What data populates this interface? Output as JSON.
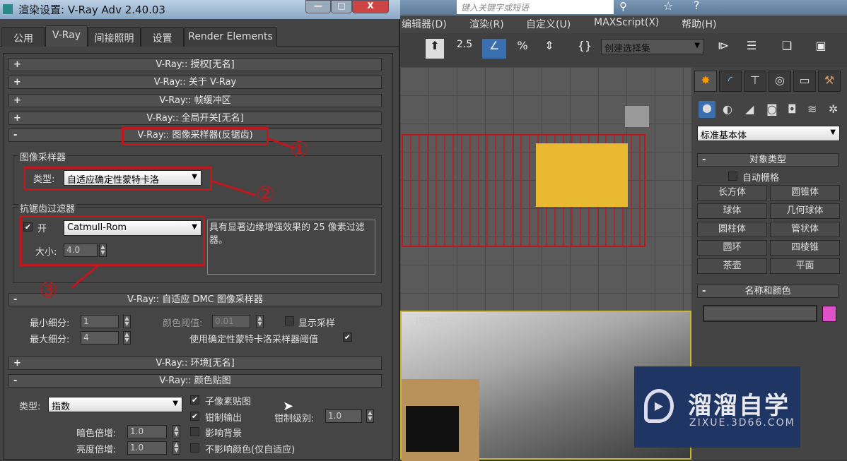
{
  "dialog": {
    "title": "渲染设置: V-Ray Adv 2.40.03",
    "tabs": [
      "公用",
      "V-Ray",
      "间接照明",
      "设置",
      "Render Elements"
    ],
    "rollouts": {
      "license": "V-Ray:: 授权[无名]",
      "about": "V-Ray:: 关于 V-Ray",
      "framebuffer": "V-Ray:: 帧缓冲区",
      "global": "V-Ray:: 全局开关[无名]",
      "image_sampler": "V-Ray:: 图像采样器(反锯齿)",
      "dmc": "V-Ray:: 自适应 DMC 图像采样器",
      "env": "V-Ray:: 环境[无名]",
      "color_mapping": "V-Ray:: 颜色贴图"
    },
    "signs": {
      "plus": "+",
      "minus": "-"
    },
    "image_sampler": {
      "group": "图像采样器",
      "type_label": "类型:",
      "type_value": "自适应确定性蒙特卡洛"
    },
    "aa_filter": {
      "group": "抗锯齿过滤器",
      "on_label": "开",
      "on_checked": true,
      "filter": "Catmull-Rom",
      "size_label": "大小:",
      "size_value": "4.0",
      "description": "具有显著边缘增强效果的 25 像素过滤器。"
    },
    "dmc": {
      "min_label": "最小细分:",
      "min_value": "1",
      "max_label": "最大细分:",
      "max_value": "4",
      "thresh_label": "颜色阈值:",
      "thresh_value": "0.01",
      "show_label": "显示采样",
      "show_checked": false,
      "use_label": "使用确定性蒙特卡洛采样器阈值",
      "use_checked": true
    },
    "color_mapping": {
      "type_label": "类型:",
      "type_value": "指数",
      "subpixel_label": "子像素贴图",
      "subpixel_checked": true,
      "clamp_label": "钳制输出",
      "clamp_checked": true,
      "clamp_level_label": "钳制级别:",
      "clamp_level_value": "1.0",
      "dark_label": "暗色倍增:",
      "dark_value": "1.0",
      "bright_label": "亮度倍增:",
      "bright_value": "1.0",
      "affect_bg_label": "影响背景",
      "affect_bg_checked": false,
      "no_affect_label": "不影响颜色(仅自适应)",
      "no_affect_checked": false
    },
    "annotations": [
      "①",
      "②",
      "③"
    ]
  },
  "max": {
    "search_placeholder": "键入关键字或短语",
    "menus": [
      "编辑器(D)",
      "渲染(R)",
      "自定义(U)",
      "MAXScript(X)",
      "帮助(H)"
    ],
    "snap_value": "2.5",
    "selection_set": "创建选择集",
    "viewport_label": "[明暗处理]",
    "command_panel": {
      "category": "标准基本体",
      "object_type_title": "对象类型",
      "autogrid": "自动栅格",
      "buttons": [
        "长方体",
        "圆锥体",
        "球体",
        "几何球体",
        "圆柱体",
        "管状体",
        "圆环",
        "四棱锥",
        "茶壶",
        "平面"
      ],
      "name_color_title": "名称和颜色",
      "object_color": "#e050c8"
    }
  },
  "watermark": {
    "title": "溜溜自学",
    "url": "ZIXUE.3D66.COM"
  },
  "colors": {
    "annotation": "#c0161c",
    "watermark_bg": "#1f3563"
  }
}
